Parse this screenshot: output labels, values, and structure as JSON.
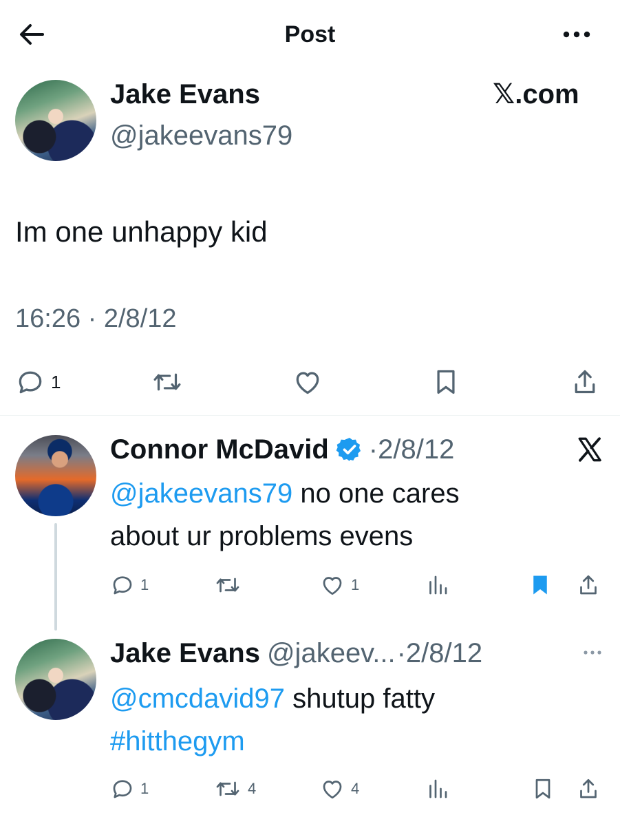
{
  "header": {
    "title": "Post"
  },
  "main_tweet": {
    "author_name": "Jake Evans",
    "author_handle": "@jakeevans79",
    "source_brand": "𝕏.com",
    "text": "Im one unhappy kid",
    "timestamp": "16:26 · 2/8/12",
    "reply_count": "1"
  },
  "replies": [
    {
      "author_name": "Connor McDavid",
      "verified": true,
      "date": "·2/8/12",
      "mention": "@jakeevans79",
      "text_line1": " no one cares",
      "text_line2": "about ur problems evens",
      "reply_count": "1",
      "like_count": "1",
      "bookmarked": true
    },
    {
      "author_name": "Jake Evans",
      "author_handle": "@jakeev...",
      "date": "·2/8/12",
      "mention": "@cmcdavid97",
      "text_line1": " shutup fatty",
      "hashtag": "#hitthegym",
      "reply_count": "1",
      "retweet_count": "4",
      "like_count": "4"
    }
  ],
  "colors": {
    "accent": "#1d9bf0",
    "text_primary": "#0f1419",
    "text_secondary": "#536471",
    "divider": "#eff3f4"
  },
  "icons": [
    "back-arrow-icon",
    "more-horizontal-icon",
    "x-logo-icon",
    "reply-icon",
    "retweet-icon",
    "like-icon",
    "bookmark-icon",
    "share-icon",
    "verified-badge-icon",
    "views-icon"
  ]
}
